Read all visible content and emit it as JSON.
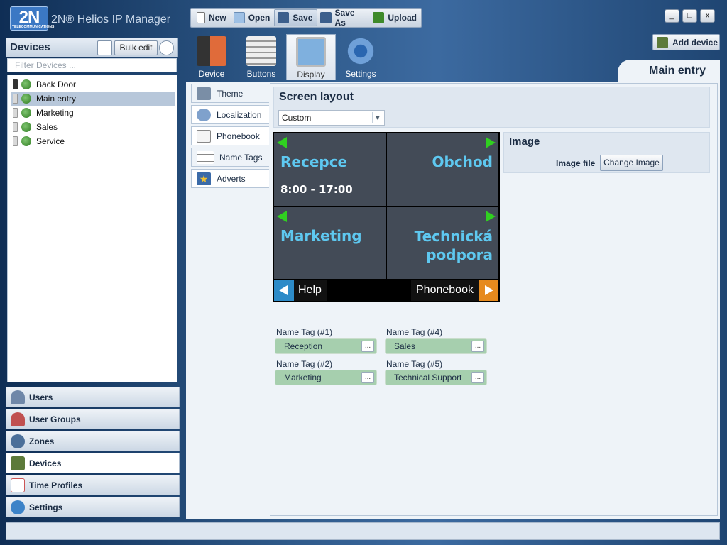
{
  "app": {
    "logo_text": "2N",
    "logo_sub": "TELECOMMUNICATIONS",
    "title": "2N® Helios IP Manager"
  },
  "toolbar": {
    "new": "New",
    "open": "Open",
    "save": "Save",
    "save_as": "Save As",
    "upload": "Upload"
  },
  "window": {
    "minimize": "_",
    "maximize": "□",
    "close": "x"
  },
  "add_device": "Add device",
  "sidebar": {
    "title": "Devices",
    "bulk_edit": "Bulk edit",
    "filter_placeholder": "Filter Devices ...",
    "devices": [
      {
        "name": "Back Door",
        "selected": false
      },
      {
        "name": "Main entry",
        "selected": true
      },
      {
        "name": "Marketing",
        "selected": false
      },
      {
        "name": "Sales",
        "selected": false
      },
      {
        "name": "Service",
        "selected": false
      }
    ],
    "nav": [
      {
        "label": "Users",
        "active": false
      },
      {
        "label": "User Groups",
        "active": false
      },
      {
        "label": "Zones",
        "active": false
      },
      {
        "label": "Devices",
        "active": true
      },
      {
        "label": "Time Profiles",
        "active": false
      },
      {
        "label": "Settings",
        "active": false
      }
    ]
  },
  "main_tabs": [
    "Device",
    "Buttons",
    "Display",
    "Settings"
  ],
  "active_main_tab": "Display",
  "device_tab_title": "Main entry",
  "side_tabs": [
    "Theme",
    "Localization",
    "Phonebook",
    "Name Tags",
    "Adverts"
  ],
  "screen_layout": {
    "title": "Screen layout",
    "selected": "Custom"
  },
  "image": {
    "title": "Image",
    "file_label": "Image file",
    "change_button": "Change Image"
  },
  "display_preview": {
    "cells": [
      "Recepce",
      "Obchod",
      "Marketing",
      "Technická podpora"
    ],
    "hours": "8:00 - 17:00",
    "help": "Help",
    "phonebook": "Phonebook"
  },
  "name_tags": [
    {
      "label": "Name Tag (#1)",
      "value": "Reception"
    },
    {
      "label": "Name Tag (#4)",
      "value": "Sales"
    },
    {
      "label": "Name Tag (#2)",
      "value": "Marketing"
    },
    {
      "label": "Name Tag (#5)",
      "value": "Technical Support"
    }
  ],
  "more_button": "...",
  "colors": {
    "accent_blue": "#5ec8f0",
    "arrow_green": "#30d020",
    "name_tag_green": "#a6cfae",
    "phonebook_orange": "#e68a1e",
    "help_blue": "#2d8bc8"
  }
}
